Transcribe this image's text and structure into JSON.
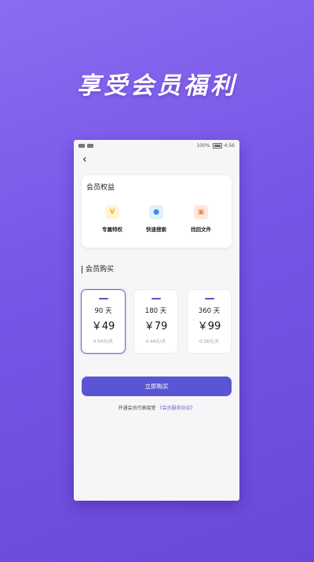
{
  "promo": {
    "title": "享受会员福利"
  },
  "status_bar": {
    "battery": "100%",
    "time": "4:56"
  },
  "nav": {
    "back_icon": "chevron-left-icon",
    "title": ""
  },
  "benefits": {
    "title": "会员权益",
    "items": [
      {
        "label": "专属特权",
        "icon": "v-badge-icon",
        "glyph": "V",
        "color": "#f4b400",
        "bg": "#fff4d6"
      },
      {
        "label": "快速搜索",
        "icon": "search-badge-icon",
        "glyph": "●",
        "color": "#3a8de8",
        "bg": "#e3f0fd"
      },
      {
        "label": "找回文件",
        "icon": "lock-icon",
        "glyph": "▣",
        "color": "#f08a3a",
        "bg": "#fde8dc"
      }
    ]
  },
  "purchase": {
    "title": "会员购买",
    "plans": [
      {
        "duration": "90 天",
        "price": "￥49",
        "daily": "0.54元/天",
        "selected": true
      },
      {
        "duration": "180 天",
        "price": "￥79",
        "daily": "0.44元/天",
        "selected": false
      },
      {
        "duration": "360 天",
        "price": "￥99",
        "daily": "0.28元/天",
        "selected": false
      }
    ],
    "buy_label": "立即购买",
    "agreement_text": "开通会员代表接受",
    "agreement_link": "《会员服务协议》"
  },
  "colors": {
    "accent": "#5a55d2",
    "background_top": "#8a6cf0",
    "background_bottom": "#6a48d8"
  }
}
